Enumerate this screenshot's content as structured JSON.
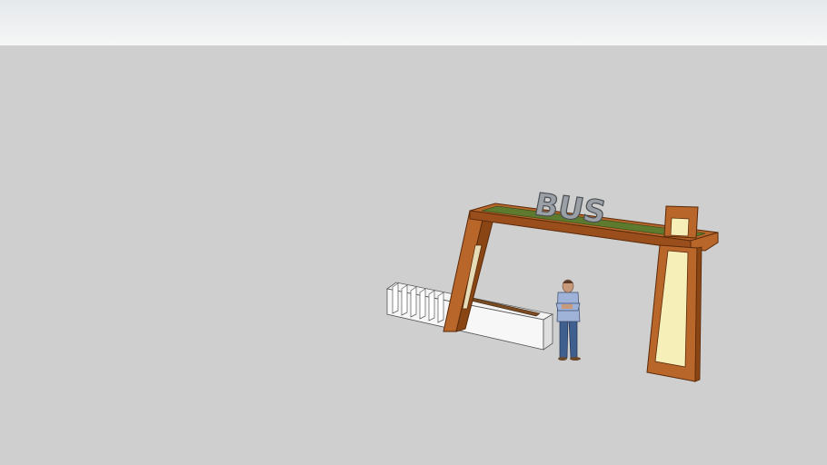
{
  "scene": {
    "sign_text": "BUS",
    "colors": {
      "sky": "#eef0f2",
      "ground": "#cfcfcf",
      "wood": "#b8662a",
      "wood_dark": "#8a4515",
      "wood_edge": "#5a2a0a",
      "green_top": "#5e7a2e",
      "light_panel": "#f7efb8",
      "letters": "#9aa0a5",
      "concrete": "#f4f4f4",
      "concrete_shadow": "#dedede",
      "shirt": "#9fb3d8",
      "jeans": "#3f5f8f",
      "skin": "#c69a7a"
    },
    "objects": [
      "bus-shelter-frame",
      "bus-sign-letters",
      "bench-planter",
      "person-figure"
    ]
  }
}
